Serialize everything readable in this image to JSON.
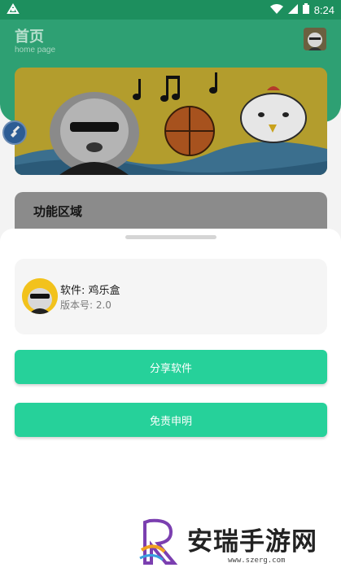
{
  "status_bar": {
    "time": "8:24"
  },
  "header": {
    "title": "首页",
    "subtitle": "home page"
  },
  "feature": {
    "title": "功能区域"
  },
  "sheet": {
    "software_label": "软件: 鸡乐盒",
    "version_label": "版本号: 2.0",
    "share_button": "分享软件",
    "disclaimer_button": "免责申明"
  },
  "watermark": {
    "brand": "安瑞手游网",
    "url": "www.szerg.com"
  },
  "colors": {
    "accent": "#26d19a",
    "header": "#2ea073"
  }
}
